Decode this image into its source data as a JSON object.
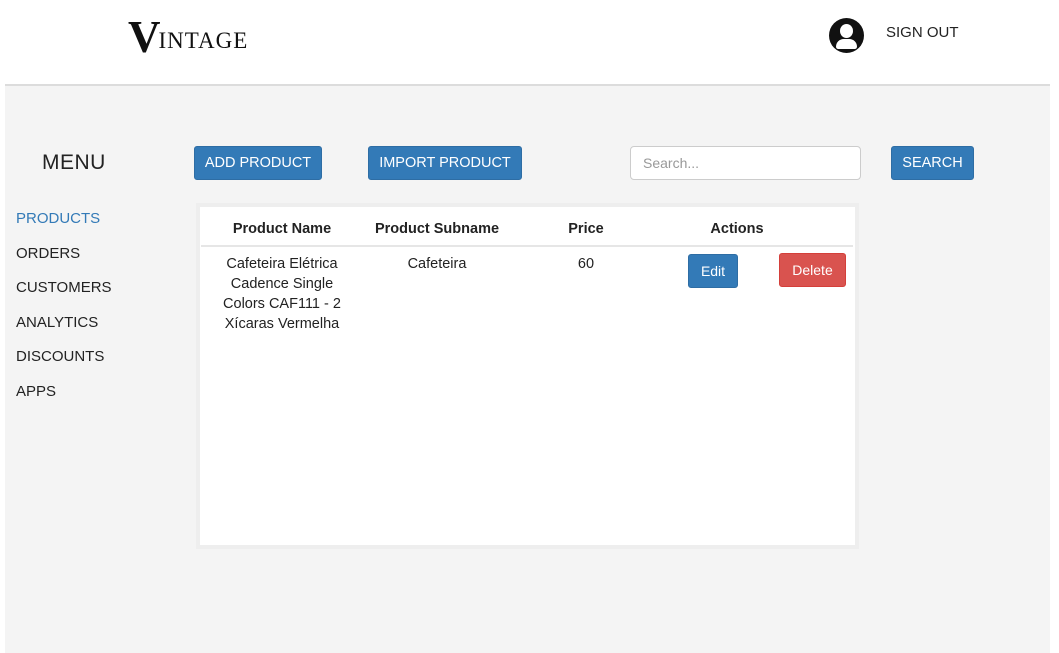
{
  "header": {
    "logo_initial": "V",
    "logo_rest": "INTAGE",
    "signout_label": "SIGN OUT"
  },
  "sidebar": {
    "title": "MENU",
    "items": [
      {
        "label": "PRODUCTS",
        "active": true
      },
      {
        "label": "ORDERS"
      },
      {
        "label": "CUSTOMERS"
      },
      {
        "label": "ANALYTICS"
      },
      {
        "label": "DISCOUNTS"
      },
      {
        "label": "APPS"
      }
    ]
  },
  "toolbar": {
    "add_label": "ADD PRODUCT",
    "import_label": "IMPORT PRODUCT",
    "search_placeholder": "Search...",
    "search_value": "",
    "search_label": "SEARCH"
  },
  "table": {
    "columns": [
      "Product Name",
      "Product Subname",
      "Price",
      "Actions"
    ],
    "rows": [
      {
        "name_lines": [
          "Cafeteira Elétrica",
          "Cadence Single",
          "Colors CAF111 - 2",
          "Xícaras Vermelha"
        ],
        "subname": "Cafeteira",
        "price": "60",
        "edit_label": "Edit",
        "delete_label": "Delete"
      }
    ]
  },
  "colors": {
    "primary": "#337ab7",
    "danger": "#d9534f",
    "background": "#f4f4f4"
  }
}
